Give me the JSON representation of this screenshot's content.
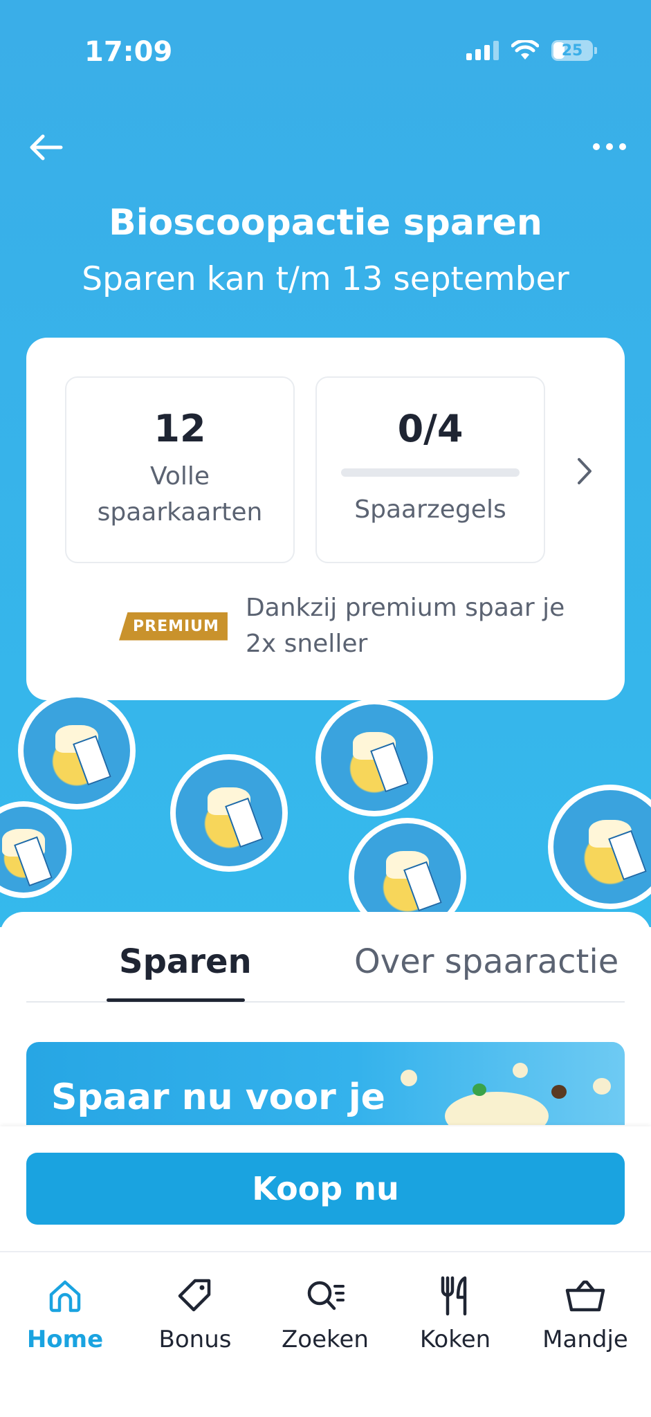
{
  "status_bar": {
    "time": "17:09",
    "battery": "25"
  },
  "header": {
    "back_icon": "arrow-left-icon",
    "more_icon": "more-horizontal-icon",
    "title": "Bioscoopactie sparen",
    "subtitle": "Sparen kan t/m 13 september"
  },
  "summary_card": {
    "full_cards": {
      "value": "12",
      "label_line1": "Volle",
      "label_line2": "spaarkaarten"
    },
    "stamps": {
      "value": "0/4",
      "label": "Spaarzegels",
      "progress": 0
    },
    "premium_badge": "PREMIUM",
    "premium_text_line1": "Dankzij premium spaar je",
    "premium_text_line2": "2x sneller"
  },
  "tabs": [
    {
      "label": "Sparen",
      "active": true
    },
    {
      "label": "Over spaaractie",
      "active": false
    }
  ],
  "promo": {
    "text": "Spaar nu voor je"
  },
  "buy_button": {
    "label": "Koop nu"
  },
  "bottom_nav": [
    {
      "label": "Home",
      "icon": "home-icon",
      "active": true
    },
    {
      "label": "Bonus",
      "icon": "tag-icon",
      "active": false
    },
    {
      "label": "Zoeken",
      "icon": "search-list-icon",
      "active": false
    },
    {
      "label": "Koken",
      "icon": "fork-knife-icon",
      "active": false
    },
    {
      "label": "Mandje",
      "icon": "basket-icon",
      "active": false
    }
  ],
  "colors": {
    "brand_blue": "#1aa3e0",
    "hero_blue": "#3aaee8",
    "premium_gold": "#c9922c",
    "text_dark": "#1f2533",
    "text_muted": "#5b6372"
  }
}
